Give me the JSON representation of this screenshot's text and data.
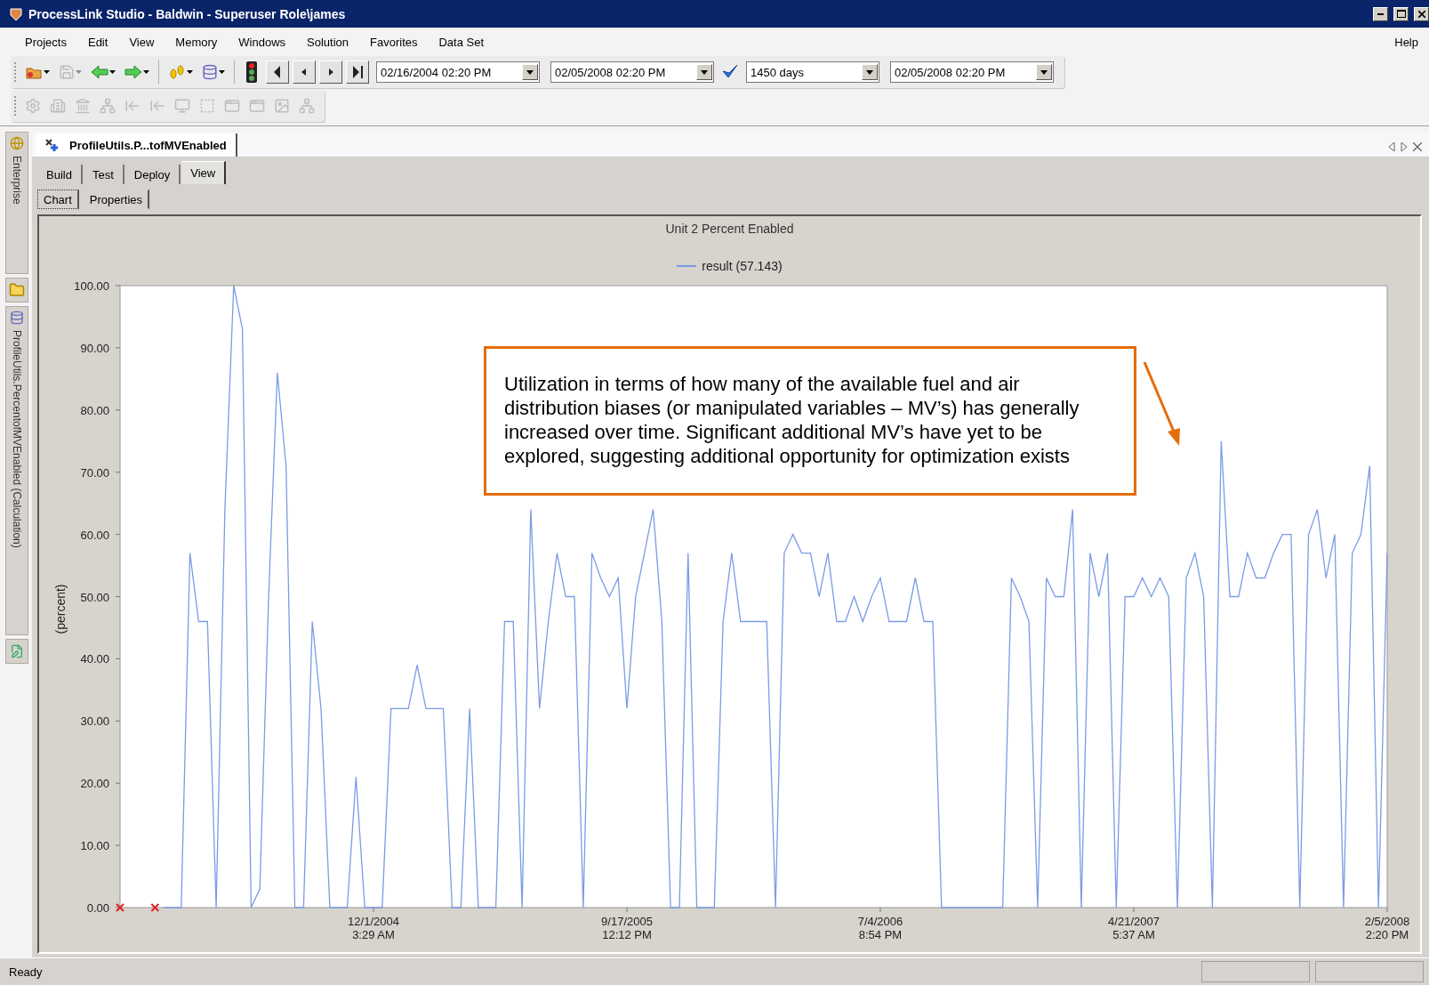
{
  "window": {
    "title": "ProcessLink Studio - Baldwin - Superuser Role\\james"
  },
  "menu": [
    {
      "label": "Projects"
    },
    {
      "label": "Edit"
    },
    {
      "label": "View"
    },
    {
      "label": "Memory"
    },
    {
      "label": "Windows"
    },
    {
      "label": "Solution"
    },
    {
      "label": "Favorites"
    },
    {
      "label": "Data Set"
    }
  ],
  "help_menu": {
    "label": "Help"
  },
  "toolbar_main": {
    "groups": [
      [
        {
          "kind": "open",
          "disabled": false,
          "dropdown": true
        },
        {
          "kind": "save",
          "disabled": true,
          "dropdown": true
        },
        {
          "kind": "back",
          "disabled": false,
          "dropdown": true
        },
        {
          "kind": "forward",
          "disabled": false,
          "dropdown": true
        }
      ],
      [
        {
          "kind": "run",
          "disabled": false,
          "dropdown": true
        },
        {
          "kind": "data",
          "disabled": false,
          "dropdown": true
        }
      ],
      [
        {
          "kind": "signal",
          "disabled": false,
          "dropdown": false
        },
        {
          "kind": "first",
          "disabled": false,
          "dropdown": false
        },
        {
          "kind": "prev",
          "disabled": false,
          "dropdown": false
        },
        {
          "kind": "next",
          "disabled": false,
          "dropdown": false
        },
        {
          "kind": "last",
          "disabled": false,
          "dropdown": false
        }
      ]
    ],
    "fields": [
      {
        "kind": "date",
        "value": "02/16/2004 02:20 PM"
      },
      {
        "kind": "date",
        "value": "02/05/2008 02:20 PM"
      },
      {
        "kind": "check"
      },
      {
        "kind": "span",
        "value": "1450 days"
      },
      {
        "kind": "date",
        "value": "02/05/2008 02:20 PM"
      }
    ]
  },
  "toolbar_secondary": {
    "items": [
      {
        "kind": "gear",
        "disabled": true
      },
      {
        "kind": "building",
        "disabled": true
      },
      {
        "kind": "bank",
        "disabled": true
      },
      {
        "kind": "tree",
        "disabled": true
      },
      {
        "kind": "left",
        "disabled": true
      },
      {
        "kind": "left",
        "disabled": true
      },
      {
        "kind": "screen",
        "disabled": true
      },
      {
        "kind": "frame",
        "disabled": true
      },
      {
        "kind": "window",
        "disabled": true
      },
      {
        "kind": "window",
        "disabled": true
      },
      {
        "kind": "image",
        "disabled": true
      },
      {
        "kind": "tree",
        "disabled": true
      }
    ]
  },
  "left_dock": [
    {
      "kind": "panel",
      "label": "Enterprise"
    },
    {
      "kind": "button"
    },
    {
      "kind": "panel",
      "label": "ProfileUtils.PercentofMVEnabled (Calculation)"
    },
    {
      "kind": "button"
    }
  ],
  "document_tabs": [
    {
      "title": "ProfileUtils.P...tofMVEnabled",
      "selected": true
    }
  ],
  "view_tabs": [
    {
      "label": "Build",
      "selected": false
    },
    {
      "label": "Test",
      "selected": false
    },
    {
      "label": "Deploy",
      "selected": false
    },
    {
      "label": "View",
      "selected": true
    }
  ],
  "sub_tabs": [
    {
      "label": "Chart",
      "selected": true
    },
    {
      "label": "Properties",
      "selected": false
    }
  ],
  "chart": {
    "chart_data": {
      "type": "line",
      "title": "Unit 2 Percent Enabled",
      "ylabel": "(percent)",
      "ylim": [
        0,
        100
      ],
      "yticks": [
        {
          "value": 0,
          "label": "0.00"
        },
        {
          "value": 10,
          "label": "10.00"
        },
        {
          "value": 20,
          "label": "20.00"
        },
        {
          "value": 30,
          "label": "30.00"
        },
        {
          "value": 40,
          "label": "40.00"
        },
        {
          "value": 50,
          "label": "50.00"
        },
        {
          "value": 60,
          "label": "60.00"
        },
        {
          "value": 70,
          "label": "70.00"
        },
        {
          "value": 80,
          "label": "80.00"
        },
        {
          "value": 90,
          "label": "90.00"
        },
        {
          "value": 100,
          "label": "100.00"
        }
      ],
      "categories": [
        null,
        null,
        null,
        null,
        null,
        null,
        null,
        null,
        null,
        null,
        null,
        null,
        null,
        null,
        null,
        null,
        null,
        null,
        null,
        null,
        null,
        null,
        null,
        null,
        null,
        null,
        null,
        null,
        null,
        "12/1/2004\n3:29 AM",
        null,
        null,
        null,
        null,
        null,
        null,
        null,
        null,
        null,
        null,
        null,
        null,
        null,
        null,
        null,
        null,
        null,
        null,
        null,
        null,
        null,
        null,
        null,
        null,
        null,
        null,
        null,
        null,
        "9/17/2005\n12:12 PM",
        null,
        null,
        null,
        null,
        null,
        null,
        null,
        null,
        null,
        null,
        null,
        null,
        null,
        null,
        null,
        null,
        null,
        null,
        null,
        null,
        null,
        null,
        null,
        null,
        null,
        null,
        null,
        null,
        "7/4/2006\n8:54 PM",
        null,
        null,
        null,
        null,
        null,
        null,
        null,
        null,
        null,
        null,
        null,
        null,
        null,
        null,
        null,
        null,
        null,
        null,
        null,
        null,
        null,
        null,
        null,
        null,
        null,
        null,
        null,
        null,
        "4/21/2007\n5:37 AM",
        null,
        null,
        null,
        null,
        null,
        null,
        null,
        null,
        null,
        null,
        null,
        null,
        null,
        null,
        null,
        null,
        null,
        null,
        null,
        null,
        null,
        null,
        null,
        null,
        null,
        null,
        null,
        null,
        "2/5/2008\n2:20 PM"
      ],
      "series": [
        {
          "name": "result (57.143)",
          "color": "#7b9be6",
          "values": [
            null,
            null,
            null,
            null,
            null,
            0,
            0,
            0,
            57,
            46,
            46,
            0,
            64,
            100,
            93,
            0,
            3,
            50,
            86,
            71,
            0,
            0,
            46,
            32,
            0,
            0,
            0,
            21,
            0,
            0,
            0,
            32,
            32,
            32,
            39,
            32,
            32,
            32,
            0,
            0,
            32,
            0,
            0,
            0,
            46,
            46,
            0,
            64,
            32,
            46,
            57,
            50,
            50,
            0,
            57,
            53,
            50,
            53,
            32,
            50,
            57,
            64,
            46,
            0,
            0,
            57,
            0,
            0,
            0,
            46,
            57,
            46,
            46,
            46,
            46,
            0,
            57,
            60,
            57,
            57,
            50,
            57,
            46,
            46,
            50,
            46,
            50,
            53,
            46,
            46,
            46,
            53,
            46,
            46,
            0,
            0,
            0,
            0,
            0,
            0,
            0,
            0,
            53,
            50,
            46,
            0,
            53,
            50,
            50,
            64,
            0,
            57,
            50,
            57,
            0,
            50,
            50,
            53,
            50,
            53,
            50,
            0,
            53,
            57,
            50,
            0,
            75,
            50,
            50,
            57,
            53,
            53,
            57,
            60,
            60,
            0,
            60,
            64,
            53,
            60,
            0,
            57,
            60,
            71,
            0,
            57
          ]
        }
      ]
    },
    "callout": {
      "text": "Utilization in terms of how many of the available fuel and air distribution biases (or manipulated variables – MV’s) has generally increased over time. Significant additional MV’s have yet to be explored, suggesting additional opportunity for optimization exists"
    }
  },
  "status_bar": {
    "text": "Ready"
  }
}
